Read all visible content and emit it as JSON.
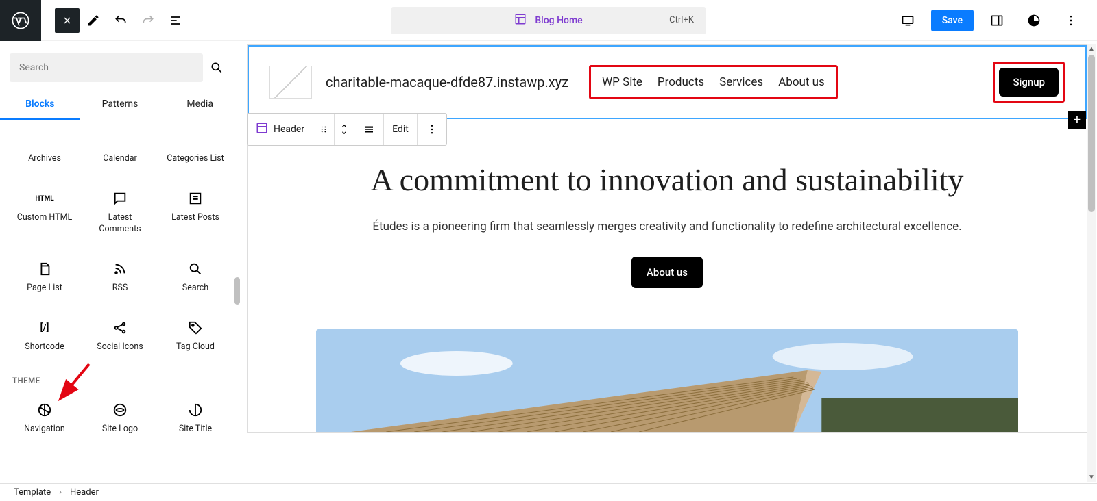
{
  "topbar": {
    "template_label": "Blog Home",
    "shortcut": "Ctrl+K",
    "save_label": "Save"
  },
  "inserter": {
    "search_placeholder": "Search",
    "tabs": {
      "blocks": "Blocks",
      "patterns": "Patterns",
      "media": "Media"
    },
    "items_row1": [
      {
        "label": "Archives"
      },
      {
        "label": "Calendar"
      },
      {
        "label": "Categories List"
      }
    ],
    "items_row2": [
      {
        "label": "Custom HTML",
        "icon": "HTML"
      },
      {
        "label": "Latest Comments"
      },
      {
        "label": "Latest Posts"
      }
    ],
    "items_row3": [
      {
        "label": "Page List"
      },
      {
        "label": "RSS"
      },
      {
        "label": "Search"
      }
    ],
    "items_row4": [
      {
        "label": "Shortcode"
      },
      {
        "label": "Social Icons"
      },
      {
        "label": "Tag Cloud"
      }
    ],
    "theme_heading": "THEME",
    "theme_items": [
      {
        "label": "Navigation"
      },
      {
        "label": "Site Logo"
      },
      {
        "label": "Site Title"
      }
    ]
  },
  "block_toolbar": {
    "block_name": "Header",
    "edit_label": "Edit"
  },
  "page": {
    "site_title": "charitable-macaque-dfde87.instawp.xyz",
    "nav": [
      "WP Site",
      "Products",
      "Services",
      "About us"
    ],
    "signup": "Signup",
    "hero_title": "A commitment to innovation and sustainability",
    "hero_text": "Études is a pioneering firm that seamlessly merges creativity and functionality to redefine architectural excellence.",
    "hero_button": "About us"
  },
  "breadcrumb": {
    "root": "Template",
    "current": "Header"
  }
}
